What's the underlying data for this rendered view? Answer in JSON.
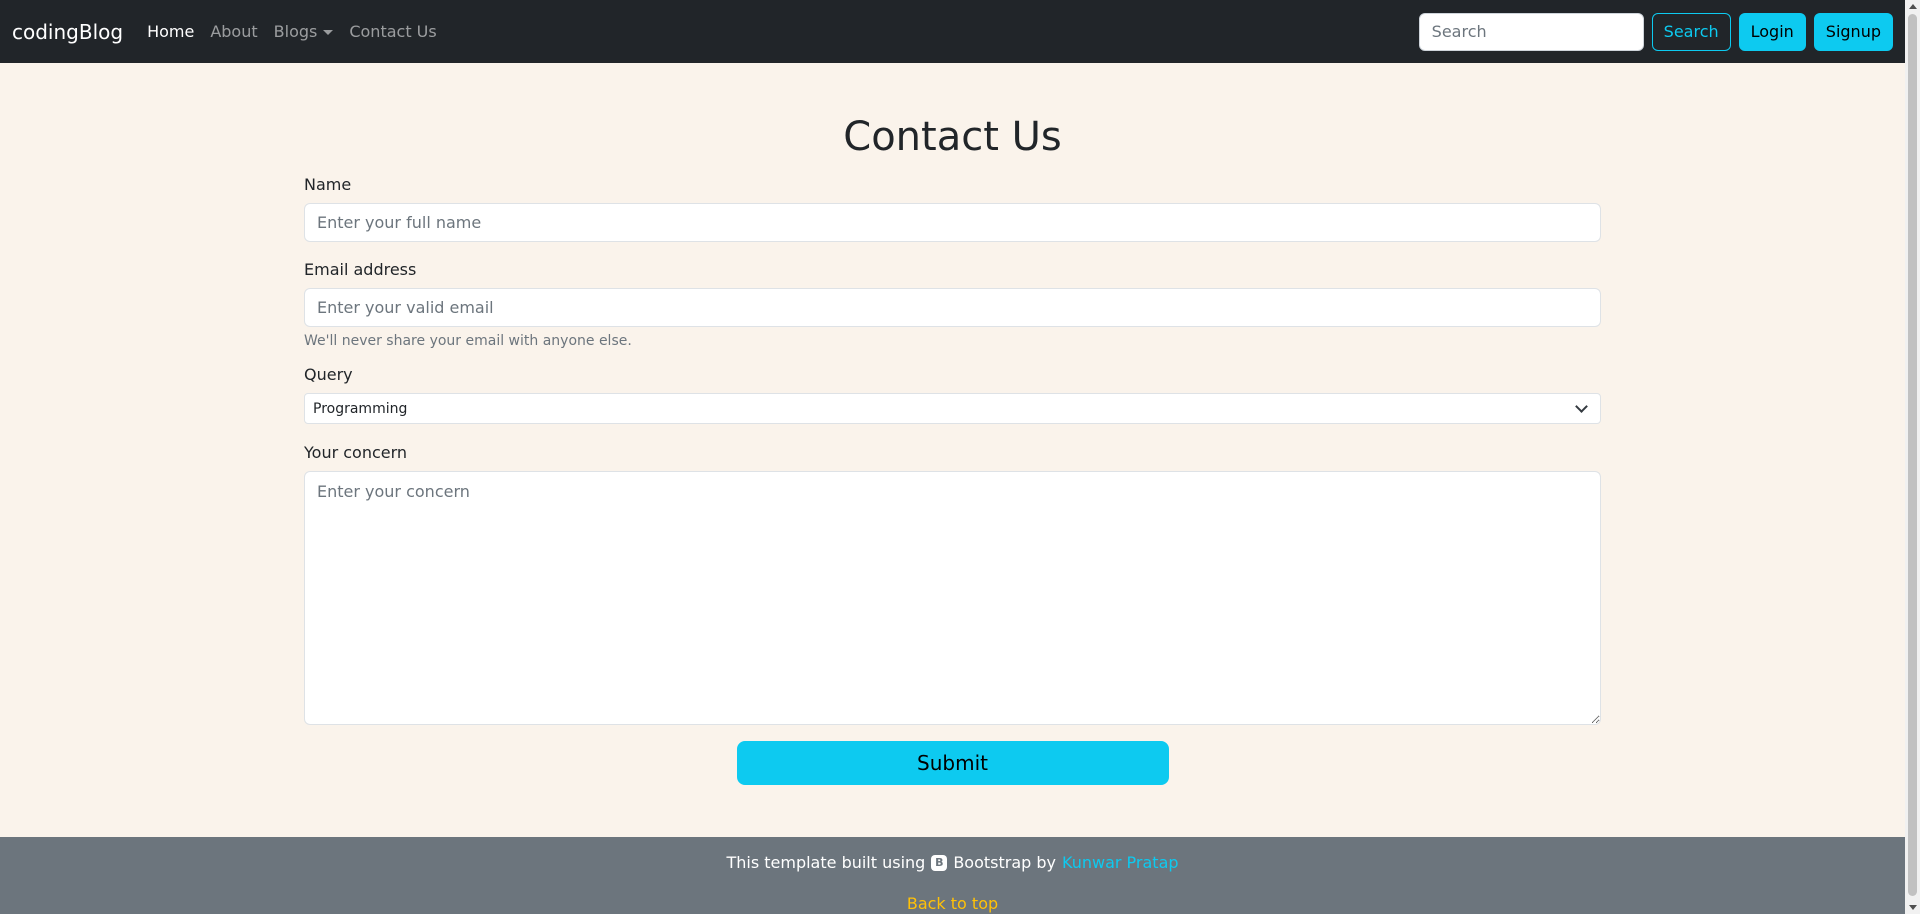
{
  "navbar": {
    "brand": "codingBlog",
    "links": [
      {
        "label": "Home",
        "active": true
      },
      {
        "label": "About",
        "active": false
      },
      {
        "label": "Blogs",
        "active": false,
        "dropdown": true
      },
      {
        "label": "Contact Us",
        "active": false
      }
    ],
    "search_placeholder": "Search",
    "search_button": "Search",
    "login_button": "Login",
    "signup_button": "Signup"
  },
  "form": {
    "title": "Contact Us",
    "name_label": "Name",
    "name_placeholder": "Enter your full name",
    "email_label": "Email address",
    "email_placeholder": "Enter your valid email",
    "email_help": "We'll never share your email with anyone else.",
    "query_label": "Query",
    "query_selected": "Programming",
    "concern_label": "Your concern",
    "concern_placeholder": "Enter your concern",
    "submit_label": "Submit"
  },
  "footer": {
    "text_before": "This template built using",
    "icon_letter": "B",
    "text_middle": "Bootstrap by",
    "author": "Kunwar Pratap",
    "back_to_top": "Back to top"
  },
  "colors": {
    "navbar_bg": "#212529",
    "page_bg": "#faf3eb",
    "accent": "#0dcaf0",
    "footer_bg": "#6c757d",
    "back_to_top": "#ffc107"
  }
}
